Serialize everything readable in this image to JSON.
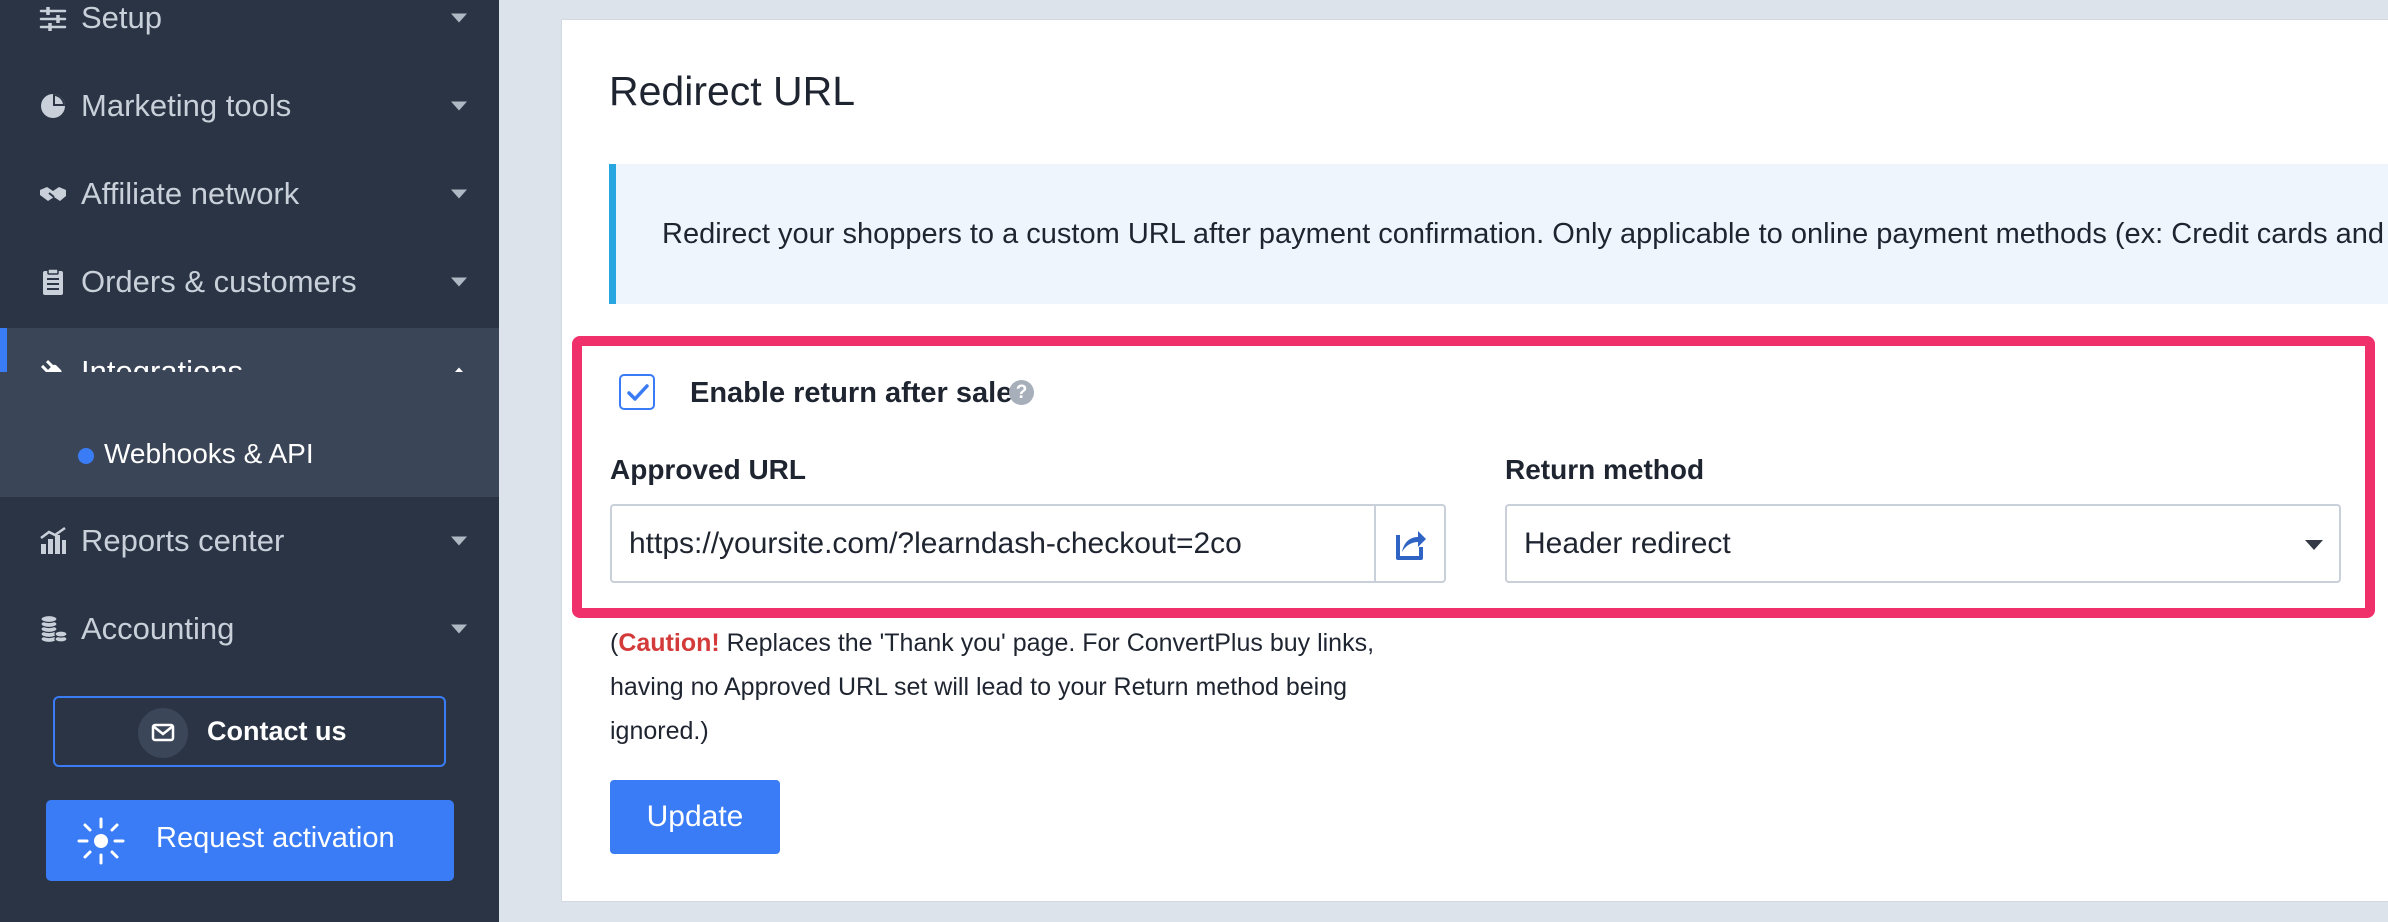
{
  "sidebar": {
    "items": [
      {
        "label": "Setup",
        "icon": "sliders-icon"
      },
      {
        "label": "Marketing tools",
        "icon": "pie-chart-icon"
      },
      {
        "label": "Affiliate network",
        "icon": "handshake-icon"
      },
      {
        "label": "Orders & customers",
        "icon": "clipboard-icon"
      },
      {
        "label": "Integrations",
        "icon": "plug-icon",
        "active": true
      },
      {
        "label": "Reports center",
        "icon": "bar-chart-icon"
      },
      {
        "label": "Accounting",
        "icon": "coins-icon"
      }
    ],
    "subitems": [
      {
        "label": "Webhooks & API"
      }
    ],
    "contact_label": "Contact us",
    "activation_label": "Request activation"
  },
  "main": {
    "title": "Redirect URL",
    "info_text": "Redirect your shoppers to a custom URL after payment confirmation. Only applicable to online payment methods (ex: Credit cards and PayPal).",
    "enable_label": "Enable return after sale",
    "enable_checked": true,
    "help_glyph": "?",
    "approved_url_label": "Approved URL",
    "approved_url_value": "https://yoursite.com/?learndash-checkout=2co",
    "return_method_label": "Return method",
    "return_method_value": "Header redirect",
    "caution_open": "(",
    "caution_word": "Caution!",
    "caution_text": " Replaces the 'Thank you' page. For ConvertPlus buy links, having no Approved URL set will lead to your Return method being ignored.)",
    "update_label": "Update"
  },
  "colors": {
    "accent": "#3a7cf5",
    "sidebar_bg": "#2a3445",
    "highlight": "#f0306a",
    "info_border": "#27a6e0",
    "caution": "#d33a3a"
  }
}
